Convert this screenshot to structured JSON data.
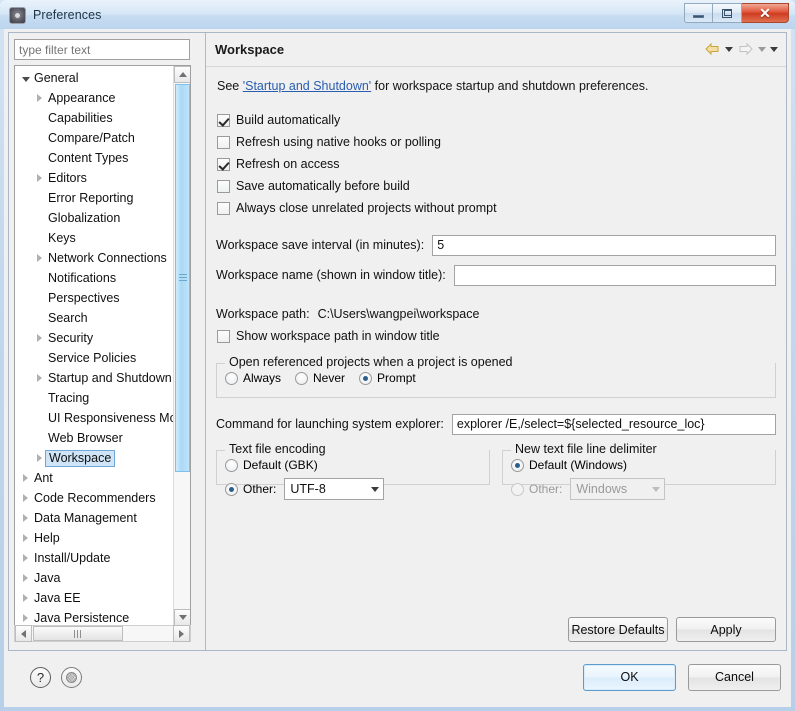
{
  "window": {
    "title": "Preferences",
    "icon": "preferences-icon",
    "controls": {
      "minimize": "Minimize",
      "maximize": "Maximize",
      "close": "Close",
      "close_glyph": "✕"
    }
  },
  "sidebar": {
    "filter": {
      "placeholder": "type filter text",
      "value": ""
    },
    "items": [
      {
        "label": "General",
        "indent": 0,
        "twisty": "expanded",
        "selected": false
      },
      {
        "label": "Appearance",
        "indent": 1,
        "twisty": "collapsed",
        "selected": false
      },
      {
        "label": "Capabilities",
        "indent": 1,
        "twisty": "none",
        "selected": false
      },
      {
        "label": "Compare/Patch",
        "indent": 1,
        "twisty": "none",
        "selected": false
      },
      {
        "label": "Content Types",
        "indent": 1,
        "twisty": "none",
        "selected": false
      },
      {
        "label": "Editors",
        "indent": 1,
        "twisty": "collapsed",
        "selected": false
      },
      {
        "label": "Error Reporting",
        "indent": 1,
        "twisty": "none",
        "selected": false
      },
      {
        "label": "Globalization",
        "indent": 1,
        "twisty": "none",
        "selected": false
      },
      {
        "label": "Keys",
        "indent": 1,
        "twisty": "none",
        "selected": false
      },
      {
        "label": "Network Connections",
        "indent": 1,
        "twisty": "collapsed",
        "selected": false
      },
      {
        "label": "Notifications",
        "indent": 1,
        "twisty": "none",
        "selected": false
      },
      {
        "label": "Perspectives",
        "indent": 1,
        "twisty": "none",
        "selected": false
      },
      {
        "label": "Search",
        "indent": 1,
        "twisty": "none",
        "selected": false
      },
      {
        "label": "Security",
        "indent": 1,
        "twisty": "collapsed",
        "selected": false
      },
      {
        "label": "Service Policies",
        "indent": 1,
        "twisty": "none",
        "selected": false
      },
      {
        "label": "Startup and Shutdown",
        "indent": 1,
        "twisty": "collapsed",
        "selected": false
      },
      {
        "label": "Tracing",
        "indent": 1,
        "twisty": "none",
        "selected": false
      },
      {
        "label": "UI Responsiveness Monitoring",
        "indent": 1,
        "twisty": "none",
        "selected": false
      },
      {
        "label": "Web Browser",
        "indent": 1,
        "twisty": "none",
        "selected": false
      },
      {
        "label": "Workspace",
        "indent": 1,
        "twisty": "collapsed",
        "selected": true
      },
      {
        "label": "Ant",
        "indent": 0,
        "twisty": "collapsed",
        "selected": false
      },
      {
        "label": "Code Recommenders",
        "indent": 0,
        "twisty": "collapsed",
        "selected": false
      },
      {
        "label": "Data Management",
        "indent": 0,
        "twisty": "collapsed",
        "selected": false
      },
      {
        "label": "Help",
        "indent": 0,
        "twisty": "collapsed",
        "selected": false
      },
      {
        "label": "Install/Update",
        "indent": 0,
        "twisty": "collapsed",
        "selected": false
      },
      {
        "label": "Java",
        "indent": 0,
        "twisty": "collapsed",
        "selected": false
      },
      {
        "label": "Java EE",
        "indent": 0,
        "twisty": "collapsed",
        "selected": false
      },
      {
        "label": "Java Persistence",
        "indent": 0,
        "twisty": "collapsed",
        "selected": false
      }
    ]
  },
  "page": {
    "title": "Workspace",
    "nav": {
      "back": "back-arrow",
      "back_menu": "back-dropdown",
      "forward": "forward-arrow",
      "forward_menu": "forward-dropdown",
      "view_menu": "view-menu"
    },
    "intro": {
      "prefix": "See ",
      "link": "'Startup and Shutdown'",
      "suffix": " for workspace startup and shutdown preferences."
    },
    "checkboxes": [
      {
        "label": "Build automatically",
        "mnemonic": "B",
        "checked": true
      },
      {
        "label": "Refresh using native hooks or polling",
        "mnemonic": "R",
        "checked": false
      },
      {
        "label": "Refresh on access",
        "mnemonic": "s",
        "checked": true
      },
      {
        "label": "Save automatically before build",
        "mnemonic": "m",
        "checked": false
      },
      {
        "label": "Always close unrelated projects without prompt",
        "mnemonic": "c",
        "checked": false
      }
    ],
    "save_interval": {
      "label": "Workspace save interval (in minutes):",
      "value": "5"
    },
    "workspace_name": {
      "label": "Workspace name (shown in window title):",
      "value": ""
    },
    "workspace_path": {
      "label": "Workspace path:",
      "value": "C:\\Users\\wangpei\\workspace"
    },
    "show_path_checkbox": {
      "label": "Show workspace path in window title",
      "checked": false
    },
    "referenced_projects": {
      "title": "Open referenced projects when a project is opened",
      "options": [
        {
          "label": "Always",
          "selected": false
        },
        {
          "label": "Never",
          "selected": false
        },
        {
          "label": "Prompt",
          "selected": true
        }
      ]
    },
    "explorer_command": {
      "label": "Command for launching system explorer:",
      "value": "explorer /E,/select=${selected_resource_loc}"
    },
    "text_file_encoding": {
      "title": "Text file encoding",
      "default_label": "Default (GBK)",
      "default_selected": false,
      "other_label": "Other:",
      "other_selected": true,
      "other_value": "UTF-8"
    },
    "line_delimiter": {
      "title": "New text file line delimiter",
      "default_label": "Default (Windows)",
      "default_selected": true,
      "other_label": "Other:",
      "other_selected": false,
      "other_value": "Windows",
      "other_disabled": true
    },
    "buttons": {
      "restore_defaults": "Restore Defaults",
      "apply": "Apply"
    }
  },
  "footer": {
    "help_icon": "?",
    "settings_icon": "gear-icon",
    "ok": "OK",
    "cancel": "Cancel"
  },
  "colors": {
    "accent_selection": "#cfe4f7",
    "link": "#2a5db0",
    "close_button": "#cf3b21",
    "scrollbar_thumb": "#a8d9f6"
  }
}
